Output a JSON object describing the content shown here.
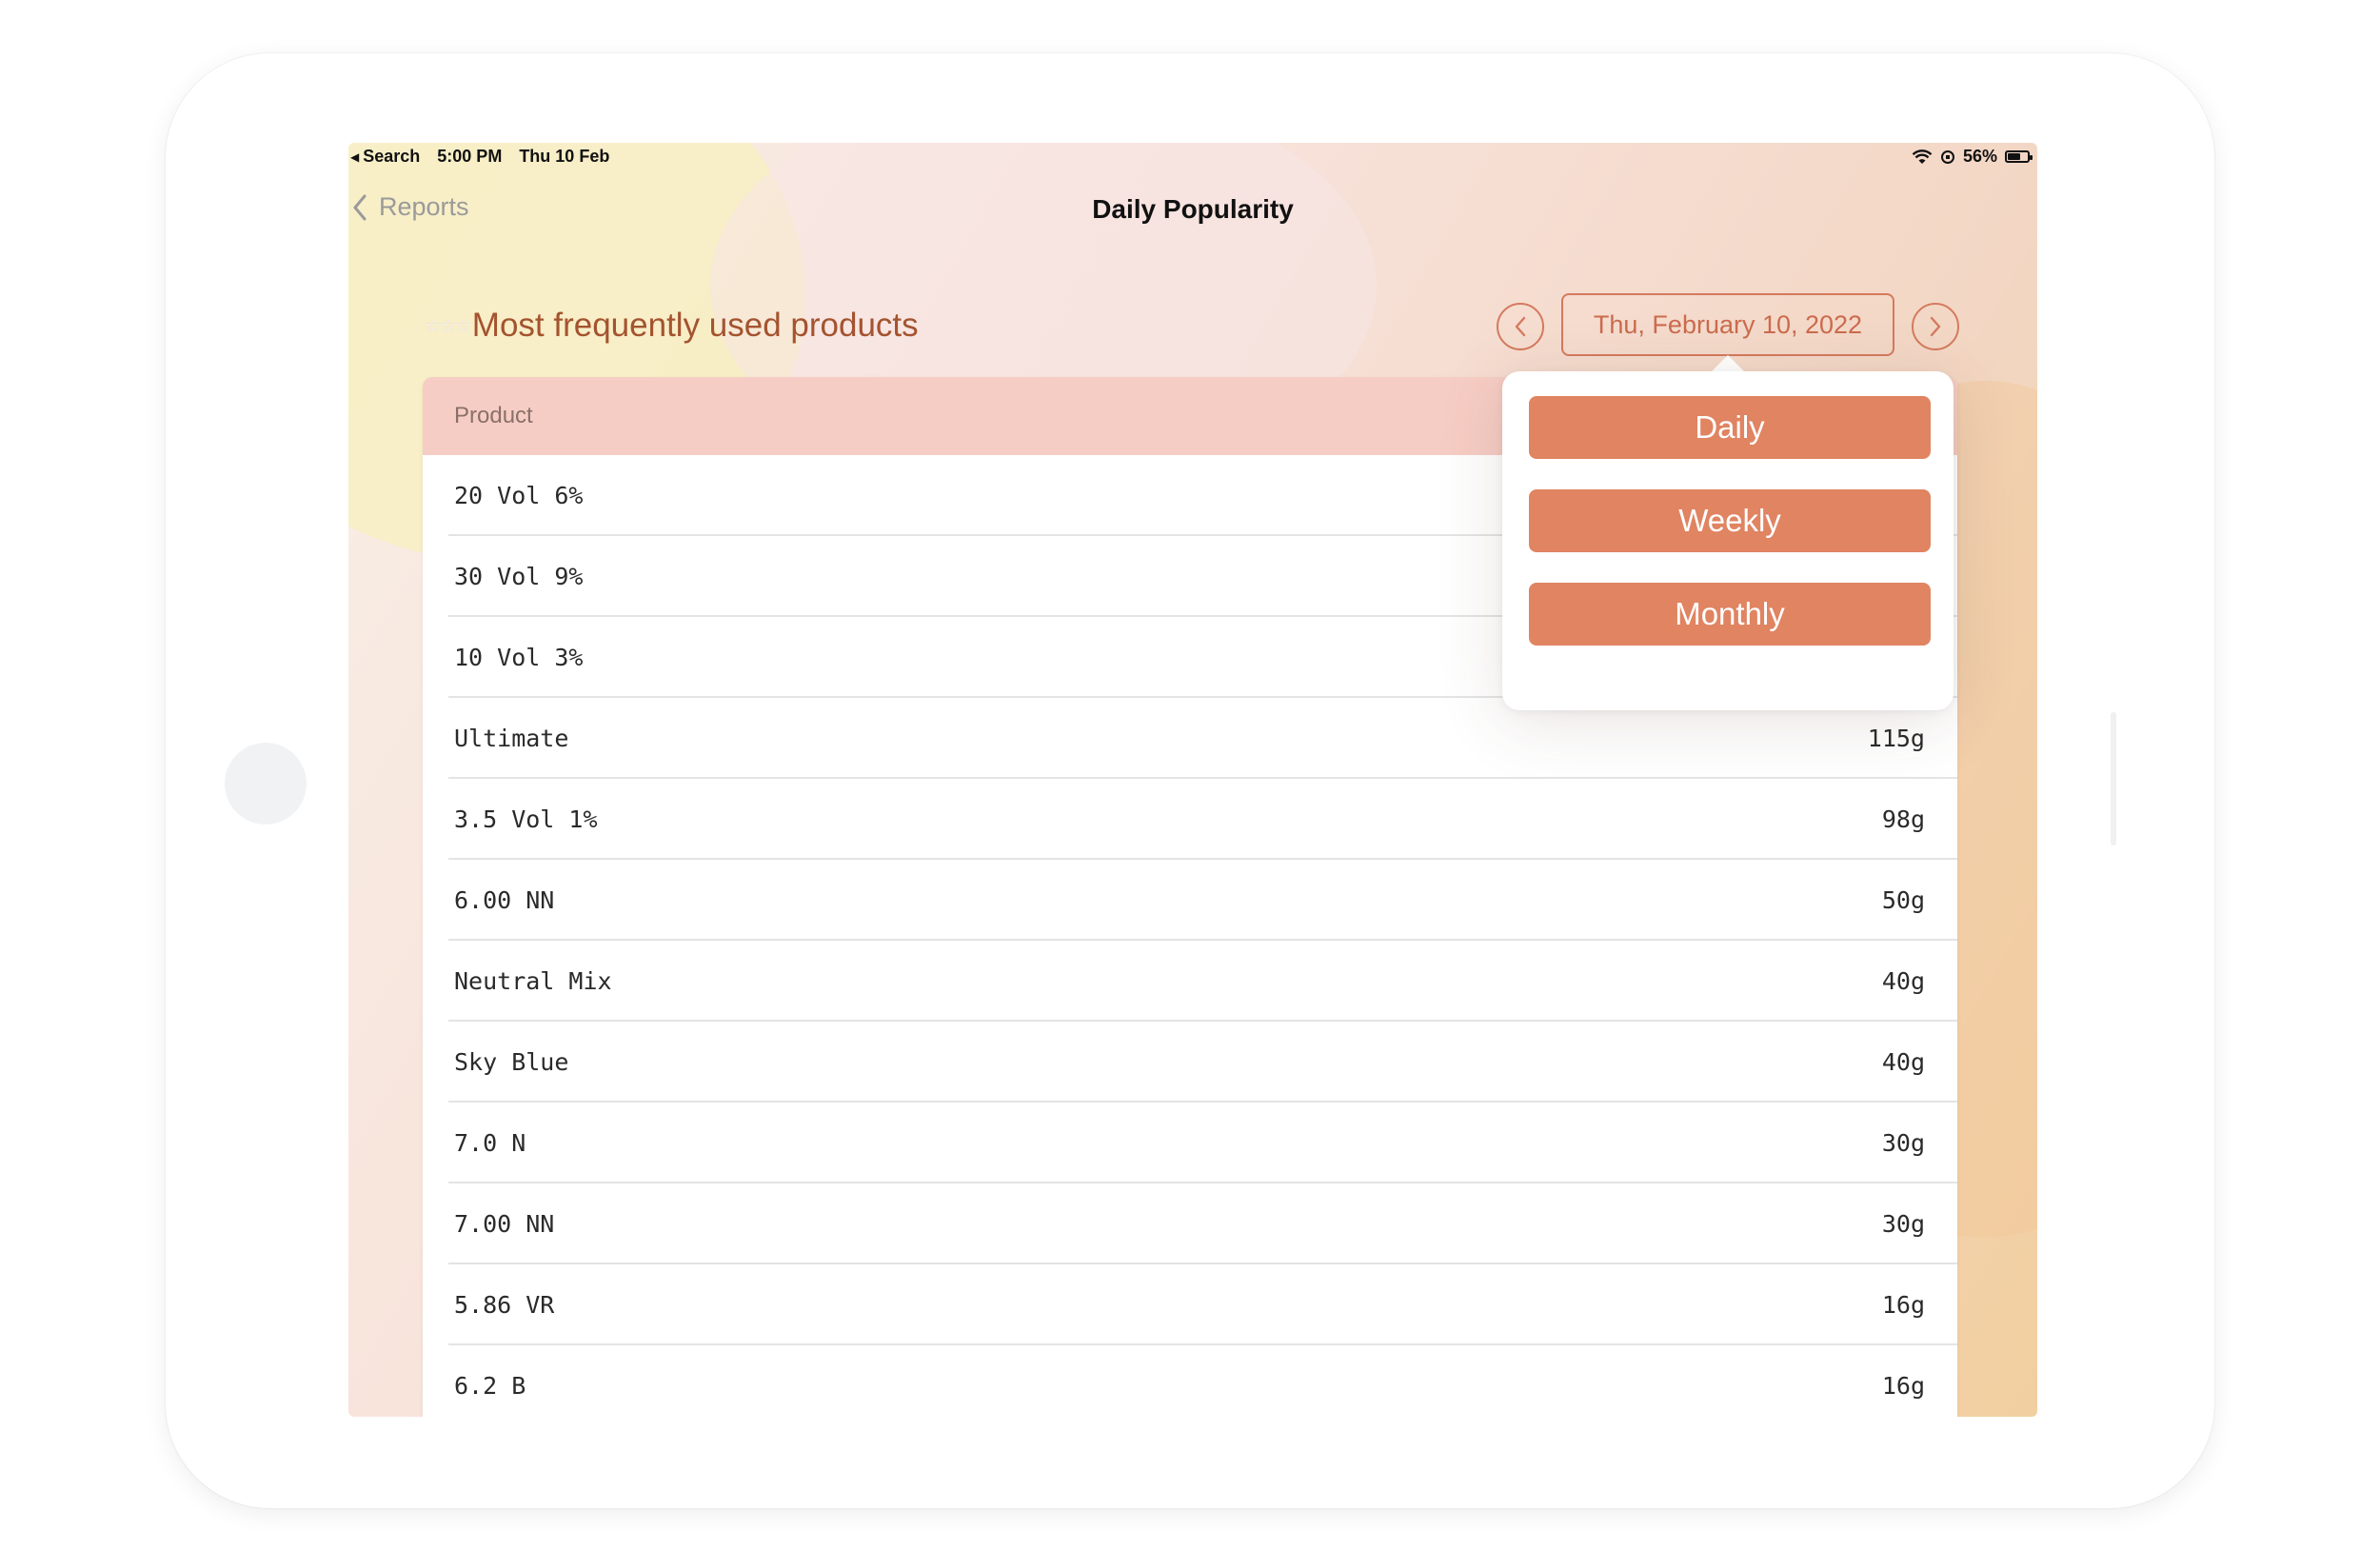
{
  "status_bar": {
    "back_app": "Search",
    "time": "5:00 PM",
    "date": "Thu 10 Feb",
    "battery": "56%"
  },
  "nav": {
    "back_label": "Reports",
    "title": "Daily Popularity"
  },
  "section": {
    "title": "Most frequently used products",
    "stars": "☆☆☆"
  },
  "date_nav": {
    "current": "Thu, February 10, 2022"
  },
  "table": {
    "header": "Product",
    "rows": [
      {
        "product": "20 Vol 6%",
        "amount": ""
      },
      {
        "product": "30 Vol 9%",
        "amount": ""
      },
      {
        "product": "10 Vol 3%",
        "amount": ""
      },
      {
        "product": "Ultimate",
        "amount": "115g"
      },
      {
        "product": "3.5 Vol 1%",
        "amount": "98g"
      },
      {
        "product": "6.00 NN",
        "amount": "50g"
      },
      {
        "product": "Neutral Mix",
        "amount": "40g"
      },
      {
        "product": "Sky Blue",
        "amount": "40g"
      },
      {
        "product": "7.0 N",
        "amount": "30g"
      },
      {
        "product": "7.00 NN",
        "amount": "30g"
      },
      {
        "product": "5.86 VR",
        "amount": "16g"
      },
      {
        "product": "6.2 B",
        "amount": "16g"
      }
    ]
  },
  "period_menu": {
    "daily": "Daily",
    "weekly": "Weekly",
    "monthly": "Monthly"
  },
  "colors": {
    "accent": "#e08462",
    "accent_text": "#a4532f",
    "table_header_bg": "#f6cdc4"
  }
}
